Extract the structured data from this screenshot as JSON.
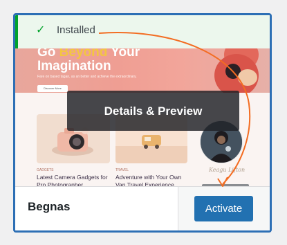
{
  "notice": {
    "icon": "checkmark-icon",
    "text": "Installed",
    "accent": "#00a32a"
  },
  "preview": {
    "hero_line1_a": "Go ",
    "hero_line1_accent": "Beyond",
    "hero_line1_b": " Your",
    "hero_line2": "Imagination",
    "hero_sub": "Fare on based tagan, as an better and achieve the extraordinary.",
    "hero_button": "Discover More",
    "post1_label": "GADGETS",
    "post1_title": "Latest Camera Gadgets for Pro Photographer",
    "post2_label": "TRAVEL",
    "post2_title": "Adventure with Your Own Van Travel Experience",
    "signature": "Keagu Lifton"
  },
  "overlay": {
    "label": "Details & Preview"
  },
  "footer": {
    "theme_name": "Begnas",
    "activate_label": "Activate",
    "activate_color": "#2271b1"
  },
  "annotation": {
    "arrow_color": "#f36c21"
  }
}
